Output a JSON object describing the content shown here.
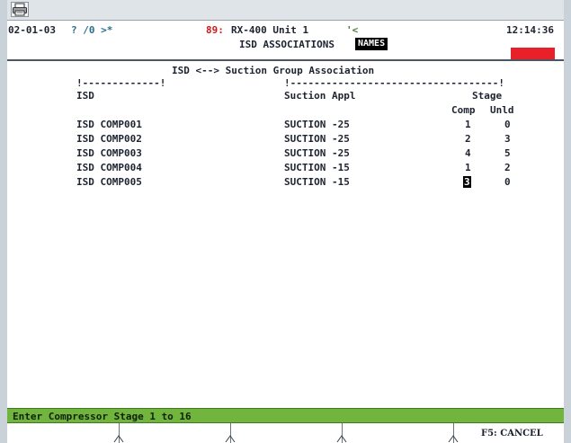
{
  "header": {
    "date": "02-01-03",
    "indicators": "? /0 >*",
    "unit_number": "89:",
    "unit_name": "RX-400 Unit 1",
    "unit_marker": "'<",
    "time": "12:14:36",
    "screen_name": "ISD ASSOCIATIONS",
    "names_badge": "NAMES",
    "alarm_color": "#e8202a"
  },
  "screen": {
    "title": "ISD <--> Suction Group Association",
    "col_isd": "ISD",
    "col_suction": "Suction Appl",
    "col_stage": "Stage",
    "col_comp": "Comp",
    "col_unld": "Unld",
    "rows": [
      {
        "isd": "ISD COMP001",
        "suction": "SUCTION -25",
        "comp": "1",
        "unld": "0"
      },
      {
        "isd": "ISD COMP002",
        "suction": "SUCTION -25",
        "comp": "2",
        "unld": "3"
      },
      {
        "isd": "ISD COMP003",
        "suction": "SUCTION -25",
        "comp": "4",
        "unld": "5"
      },
      {
        "isd": "ISD COMP004",
        "suction": "SUCTION -15",
        "comp": "1",
        "unld": "2"
      },
      {
        "isd": "ISD COMP005",
        "suction": "SUCTION -15",
        "comp": "3",
        "unld": "0"
      }
    ]
  },
  "status": {
    "message": "Enter Compressor Stage 1 to 16"
  },
  "fkeys": {
    "f5": "F5: CANCEL"
  },
  "icons": {
    "print": "printer-icon"
  }
}
